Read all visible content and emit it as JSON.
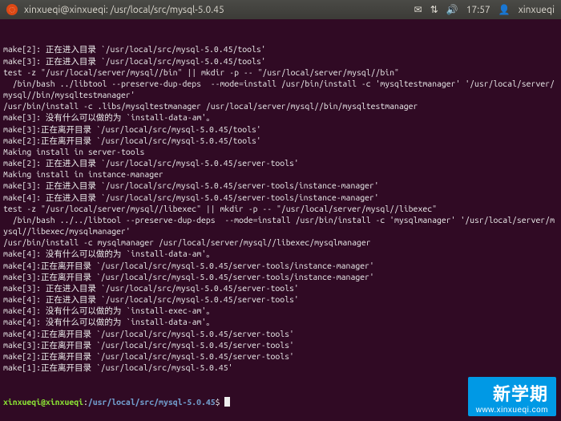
{
  "menubar": {
    "title_user": "xinxueqi@xinxueqi",
    "title_sep": ": ",
    "title_path": "/usr/local/src/mysql-5.0.45",
    "time": "17:57",
    "username": "xinxueqi",
    "icons": {
      "ubuntu": "ubuntu-logo-icon",
      "mail": "✉",
      "network": "⇅",
      "volume": "🔊",
      "user": "👤"
    }
  },
  "terminal": {
    "lines": [
      "make[2]: 正在进入目录 `/usr/local/src/mysql-5.0.45/tools'",
      "make[3]: 正在进入目录 `/usr/local/src/mysql-5.0.45/tools'",
      "test -z \"/usr/local/server/mysql//bin\" || mkdir -p -- \"/usr/local/server/mysql//bin\"",
      "  /bin/bash ../libtool --preserve-dup-deps  --mode=install /usr/bin/install -c 'mysqltestmanager' '/usr/local/server/mysql//bin/mysqltestmanager'",
      "/usr/bin/install -c .libs/mysqltestmanager /usr/local/server/mysql//bin/mysqltestmanager",
      "make[3]: 没有什么可以做的为 `install-data-am'。",
      "make[3]:正在离开目录 `/usr/local/src/mysql-5.0.45/tools'",
      "make[2]:正在离开目录 `/usr/local/src/mysql-5.0.45/tools'",
      "Making install in server-tools",
      "make[2]: 正在进入目录 `/usr/local/src/mysql-5.0.45/server-tools'",
      "Making install in instance-manager",
      "make[3]: 正在进入目录 `/usr/local/src/mysql-5.0.45/server-tools/instance-manager'",
      "make[4]: 正在进入目录 `/usr/local/src/mysql-5.0.45/server-tools/instance-manager'",
      "test -z \"/usr/local/server/mysql//libexec\" || mkdir -p -- \"/usr/local/server/mysql//libexec\"",
      "  /bin/bash ../../libtool --preserve-dup-deps  --mode=install /usr/bin/install -c 'mysqlmanager' '/usr/local/server/mysql//libexec/mysqlmanager'",
      "/usr/bin/install -c mysqlmanager /usr/local/server/mysql//libexec/mysqlmanager",
      "make[4]: 没有什么可以做的为 `install-data-am'。",
      "make[4]:正在离开目录 `/usr/local/src/mysql-5.0.45/server-tools/instance-manager'",
      "make[3]:正在离开目录 `/usr/local/src/mysql-5.0.45/server-tools/instance-manager'",
      "make[3]: 正在进入目录 `/usr/local/src/mysql-5.0.45/server-tools'",
      "make[4]: 正在进入目录 `/usr/local/src/mysql-5.0.45/server-tools'",
      "make[4]: 没有什么可以做的为 `install-exec-am'。",
      "make[4]: 没有什么可以做的为 `install-data-am'。",
      "make[4]:正在离开目录 `/usr/local/src/mysql-5.0.45/server-tools'",
      "make[3]:正在离开目录 `/usr/local/src/mysql-5.0.45/server-tools'",
      "make[2]:正在离开目录 `/usr/local/src/mysql-5.0.45/server-tools'",
      "make[1]:正在离开目录 `/usr/local/src/mysql-5.0.45'"
    ],
    "prompt": {
      "user": "xinxueqi@xinxueqi",
      "sep": ":",
      "path": "/usr/local/src/mysql-5.0.45",
      "dollar": "$"
    }
  },
  "watermark": {
    "text": "新学期",
    "url": "www.xinxueqi.com"
  }
}
